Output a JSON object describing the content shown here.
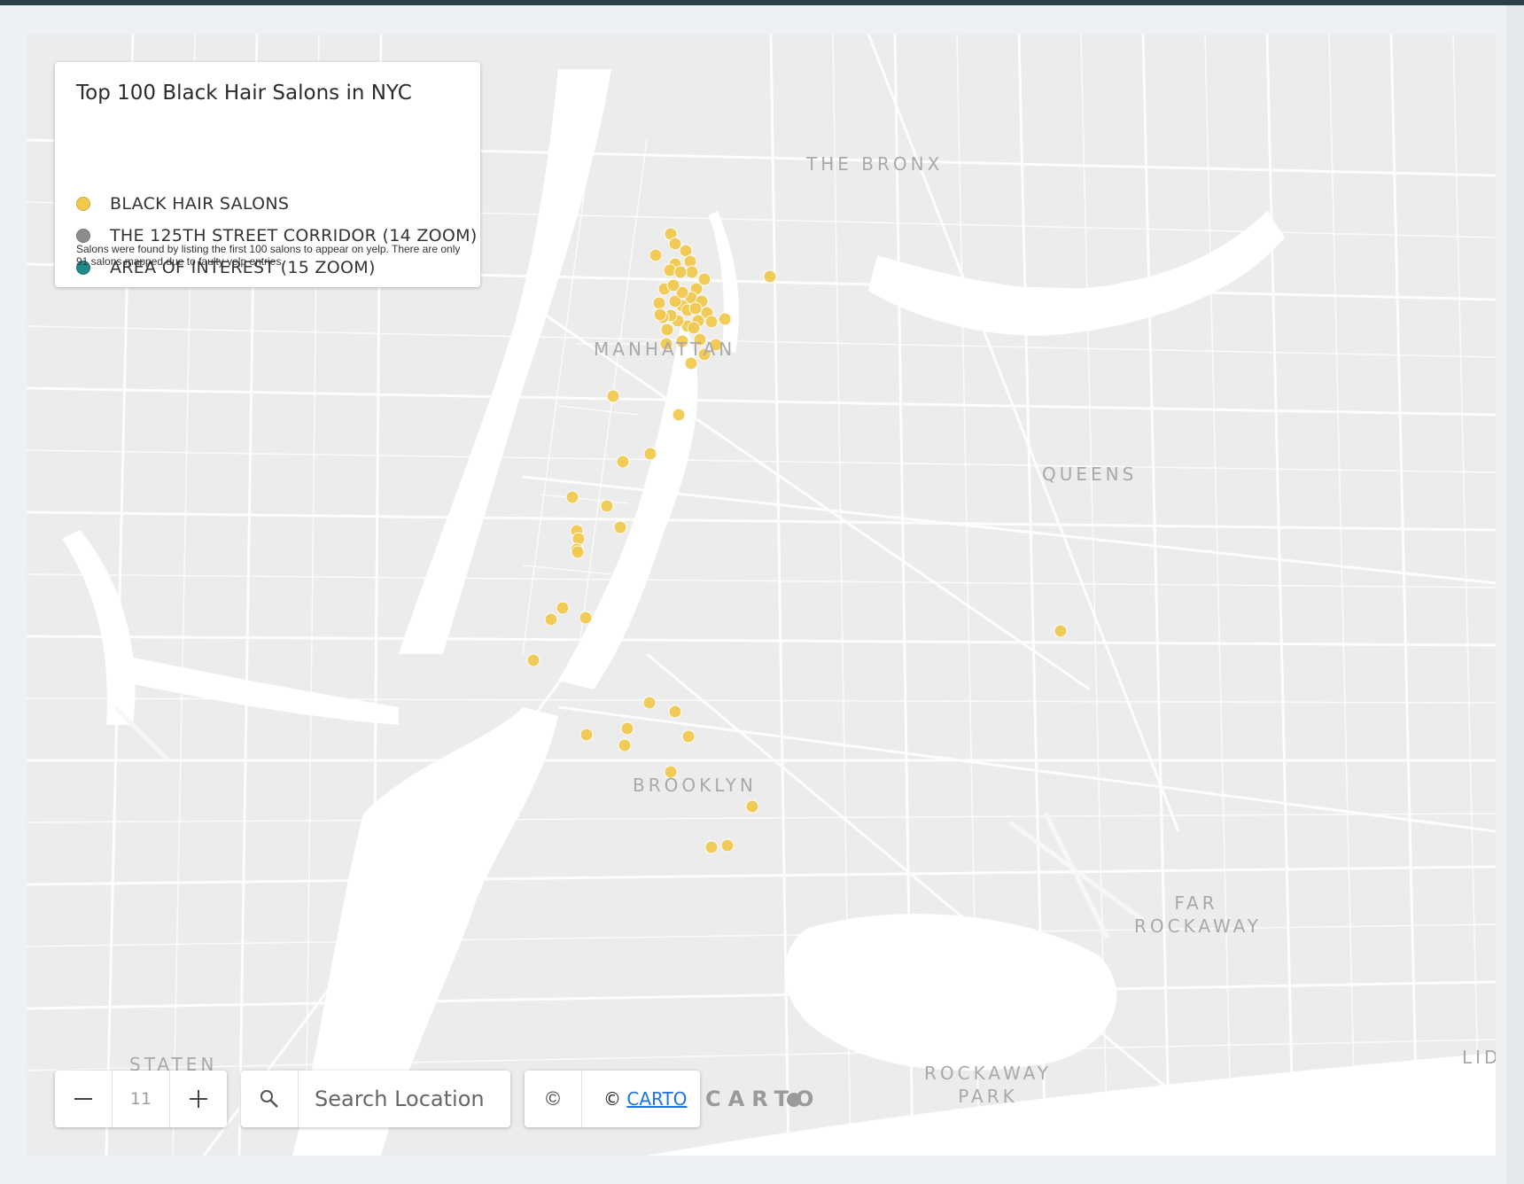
{
  "legend": {
    "title": "Top 100 Black Hair Salons in NYC",
    "items": [
      {
        "label": "BLACK HAIR SALONS",
        "color": "#f2c94c"
      },
      {
        "label": "THE 125TH STREET CORRIDOR (14 ZOOM)",
        "color": "#8c8c8c"
      },
      {
        "label": "AREA OF INTEREST (15 ZOOM)",
        "color": "#1f8a8a"
      }
    ],
    "note": "Salons were found by listing the first 100 salons to appear on yelp. There are only 91 salons mapped due to faulty yelp entries."
  },
  "place_labels": {
    "bronx": "THE BRONX",
    "manhattan": "MANHATTAN",
    "queens": "QUEENS",
    "brooklyn": "BROOKLYN",
    "staten": "STATEN",
    "far_rockaway": "FAR ROCKAWAY",
    "rockaway_park": "ROCKAWAY PARK",
    "lid": "LID"
  },
  "zoom": {
    "value": "11",
    "minus_icon": "minus-icon",
    "plus_icon": "plus-icon"
  },
  "search": {
    "placeholder": "Search Location",
    "icon": "search-icon"
  },
  "attribution": {
    "icon_glyph": "©",
    "prefix": "© ",
    "link_text": "CARTO"
  },
  "carto_logo": "CARTO",
  "colors": {
    "salon": "#f2c94c",
    "land": "#ececec",
    "water": "#ffffff",
    "road": "#ffffff"
  }
}
